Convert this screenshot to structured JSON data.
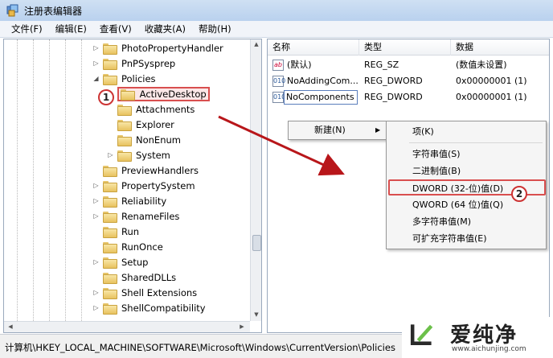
{
  "window": {
    "title": "注册表编辑器"
  },
  "menu": [
    "文件(F)",
    "编辑(E)",
    "查看(V)",
    "收藏夹(A)",
    "帮助(H)"
  ],
  "tree": [
    {
      "label": "PhotoPropertyHandler",
      "depth": 0,
      "expander": "▷"
    },
    {
      "label": "PnPSysprep",
      "depth": 0,
      "expander": "▷"
    },
    {
      "label": "Policies",
      "depth": 0,
      "expander": "◢"
    },
    {
      "label": "ActiveDesktop",
      "depth": 1,
      "expander": "",
      "selected": true
    },
    {
      "label": "Attachments",
      "depth": 1,
      "expander": ""
    },
    {
      "label": "Explorer",
      "depth": 1,
      "expander": ""
    },
    {
      "label": "NonEnum",
      "depth": 1,
      "expander": ""
    },
    {
      "label": "System",
      "depth": 1,
      "expander": "▷"
    },
    {
      "label": "PreviewHandlers",
      "depth": 0,
      "expander": ""
    },
    {
      "label": "PropertySystem",
      "depth": 0,
      "expander": "▷"
    },
    {
      "label": "Reliability",
      "depth": 0,
      "expander": "▷"
    },
    {
      "label": "RenameFiles",
      "depth": 0,
      "expander": "▷"
    },
    {
      "label": "Run",
      "depth": 0,
      "expander": ""
    },
    {
      "label": "RunOnce",
      "depth": 0,
      "expander": ""
    },
    {
      "label": "Setup",
      "depth": 0,
      "expander": "▷"
    },
    {
      "label": "SharedDLLs",
      "depth": 0,
      "expander": ""
    },
    {
      "label": "Shell Extensions",
      "depth": 0,
      "expander": "▷"
    },
    {
      "label": "ShellCompatibility",
      "depth": 0,
      "expander": "▷"
    }
  ],
  "list": {
    "columns": [
      "名称",
      "类型",
      "数据"
    ],
    "rows": [
      {
        "icon": "ab",
        "name": "(默认)",
        "type": "REG_SZ",
        "data": "(数值未设置)"
      },
      {
        "icon": "010",
        "name": "NoAddingCom...",
        "type": "REG_DWORD",
        "data": "0x00000001 (1)"
      },
      {
        "icon": "010",
        "name": "NoComponents",
        "type": "REG_DWORD",
        "data": "0x00000001 (1)",
        "editing": true
      }
    ]
  },
  "context_menu": {
    "new_label": "新建(N)",
    "submenu": [
      "项(K)",
      "字符串值(S)",
      "二进制值(B)",
      "DWORD (32-位)值(D)",
      "QWORD (64 位)值(Q)",
      "多字符串值(M)",
      "可扩充字符串值(E)"
    ]
  },
  "badges": [
    "1",
    "2"
  ],
  "status": {
    "path": "计算机\\HKEY_LOCAL_MACHINE\\SOFTWARE\\Microsoft\\Windows\\CurrentVersion\\Policies"
  },
  "watermark": {
    "brand": "爱纯净",
    "url": "www.aichunjing.com"
  },
  "colors": {
    "annotation_red": "#d94f4f",
    "arrow_red": "#b8161a"
  }
}
